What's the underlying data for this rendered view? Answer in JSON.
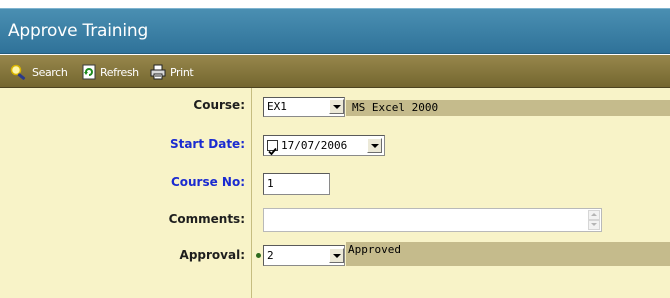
{
  "window": {
    "title": "Approve Training"
  },
  "toolbar": {
    "search_label": "Search",
    "refresh_label": "Refresh",
    "print_label": "Print"
  },
  "form": {
    "course": {
      "label": "Course:",
      "value": "EX1",
      "description": "MS Excel 2000"
    },
    "start_date": {
      "label": "Start Date:",
      "value": "17/07/2006",
      "checked": true
    },
    "course_no": {
      "label": "Course No:",
      "value": "1"
    },
    "comments": {
      "label": "Comments:",
      "value": ""
    },
    "approval": {
      "label": "Approval:",
      "value": "2",
      "description": "Approved"
    }
  },
  "colors": {
    "title_bar": "#3a80a7",
    "toolbar": "#857840",
    "form_bg": "#f8f3c8",
    "desc_panel": "#c5bb8c",
    "blue_label": "#1b2bd0"
  },
  "icons": [
    "search-icon",
    "refresh-icon",
    "print-icon"
  ]
}
